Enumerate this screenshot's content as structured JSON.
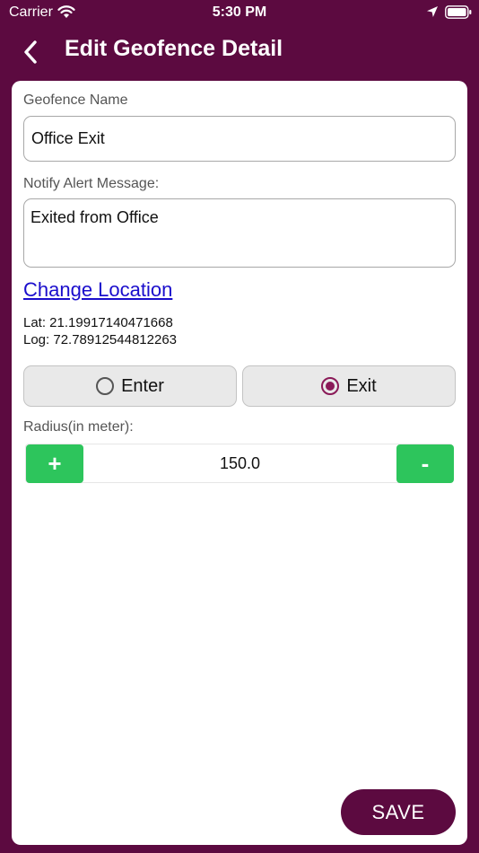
{
  "status_bar": {
    "carrier": "Carrier",
    "time": "5:30 PM",
    "icons": [
      "wifi-icon",
      "location-arrow-icon",
      "battery-icon"
    ]
  },
  "nav": {
    "title": "Edit Geofence Detail",
    "back_icon": "chevron-left-icon"
  },
  "form": {
    "name_label": "Geofence Name",
    "name_value": "Office Exit",
    "message_label": "Notify Alert Message:",
    "message_value": "Exited from Office",
    "change_location_label": "Change Location",
    "lat_text": "Lat: 21.19917140471668",
    "log_text": "Log: 72.78912544812263",
    "trigger_options": [
      {
        "label": "Enter",
        "selected": false
      },
      {
        "label": "Exit",
        "selected": true
      }
    ],
    "radius_label": "Radius(in meter):",
    "radius_value": "150.0",
    "plus_label": "+",
    "minus_label": "-",
    "save_label": "SAVE"
  },
  "colors": {
    "brand": "#5c0a40",
    "accent_green": "#2dc55c",
    "link": "#1a0dcc",
    "radio_selected": "#8a1a58"
  }
}
